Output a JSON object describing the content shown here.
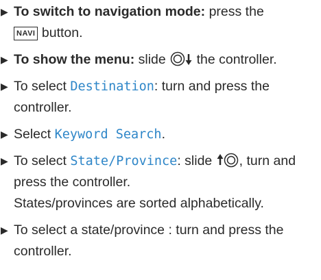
{
  "steps": [
    {
      "lead_bold": "To switch to navigation mode:",
      "text_a": " press the ",
      "key_label": "NAVI",
      "text_b": " button."
    },
    {
      "lead_bold": "To show the menu:",
      "text_a": " slide ",
      "icon": "controller-slide-down-icon",
      "text_b": " the controller."
    },
    {
      "text_a": "To select ",
      "term": "Destination",
      "text_b": ": turn and press the controller."
    },
    {
      "text_a": "Select ",
      "term": "Keyword Search",
      "text_b": "."
    },
    {
      "text_a": "To select ",
      "term": "State/Province",
      "text_b": ": slide ",
      "icon": "controller-slide-up-icon",
      "text_c": ", turn and press the controller.",
      "note": "States/provinces are sorted alphabetically."
    },
    {
      "text_a": "To select a state/province : turn and press the controller."
    }
  ],
  "colors": {
    "text": "#2a2a2a",
    "term": "#2e86c8"
  }
}
